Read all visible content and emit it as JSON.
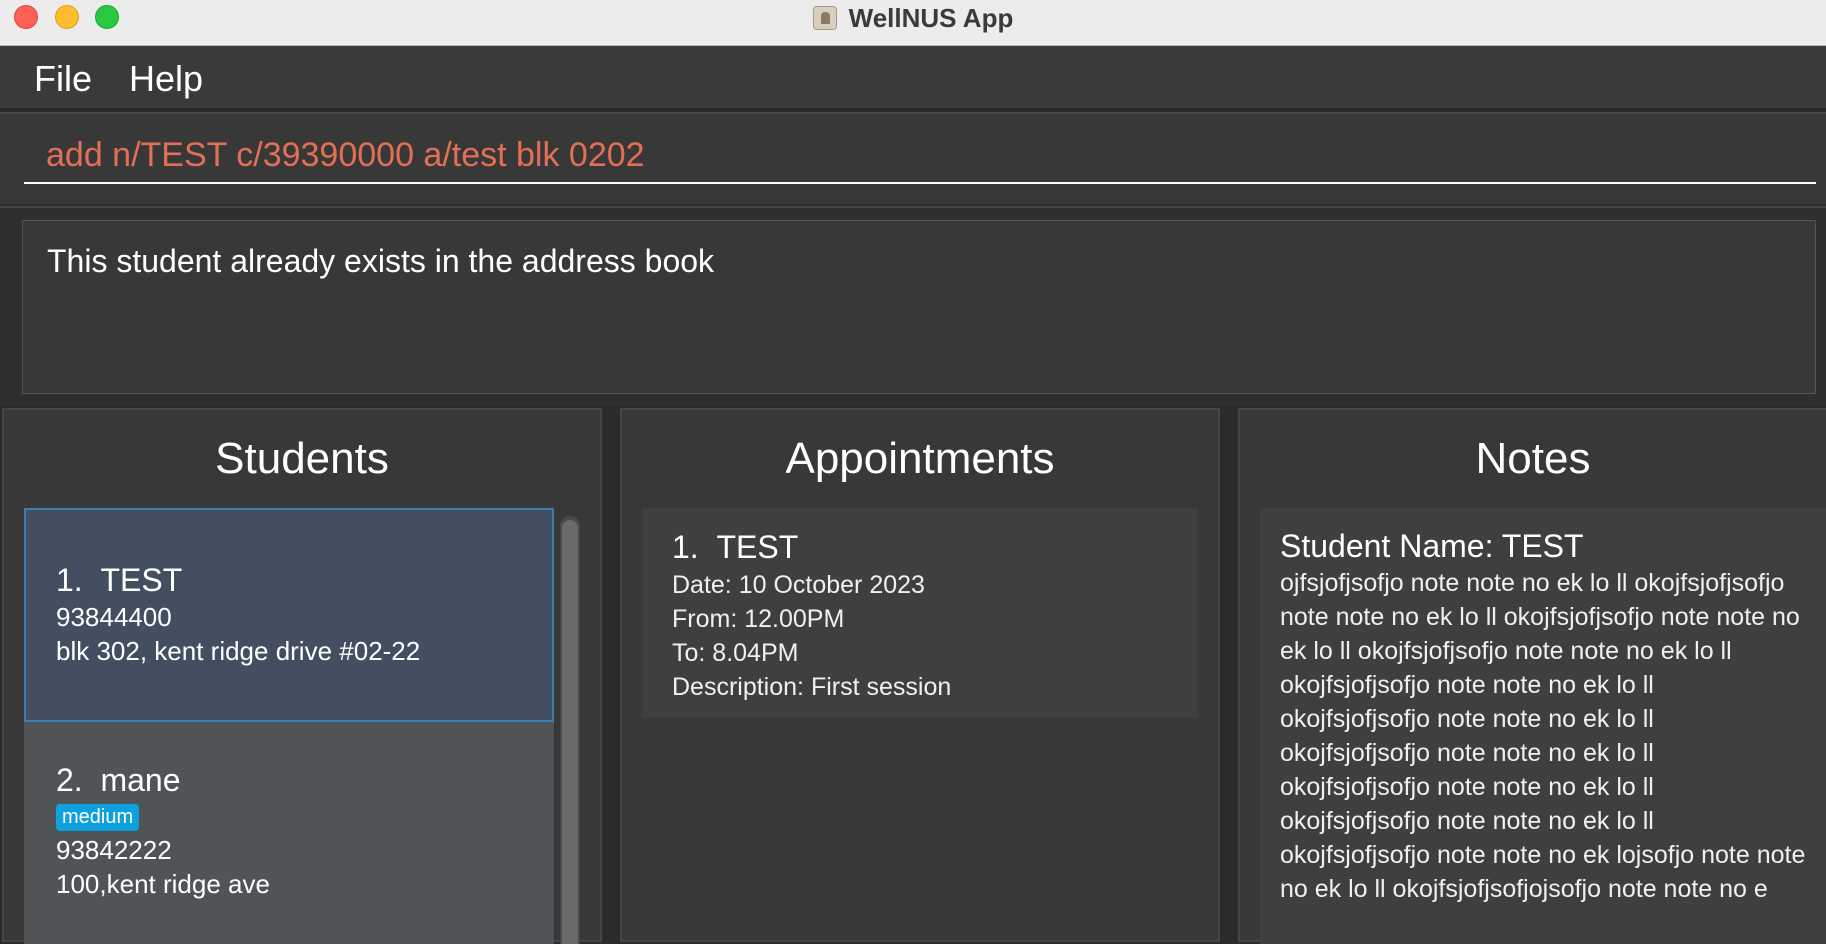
{
  "window": {
    "title": "WellNUS App"
  },
  "menu": {
    "file": "File",
    "help": "Help"
  },
  "command": {
    "value": "add n/TEST c/39390000 a/test blk 0202"
  },
  "result": {
    "message": "This student already exists in the address book"
  },
  "students": {
    "title": "Students",
    "items": [
      {
        "index": "1.",
        "name": "TEST",
        "phone": "93844400",
        "address": "blk 302, kent ridge drive #02-22"
      },
      {
        "index": "2.",
        "name": "mane",
        "tag": "medium",
        "phone": "93842222",
        "address": "100,kent ridge ave"
      }
    ]
  },
  "appointments": {
    "title": "Appointments",
    "items": [
      {
        "index": "1.",
        "name": "TEST",
        "date": "Date: 10 October 2023",
        "from": "From: 12.00PM",
        "to": "To: 8.04PM",
        "description": "Description: First session"
      }
    ]
  },
  "notes": {
    "title": "Notes",
    "student_name": "Student Name: TEST",
    "body": "ojfsjofjsofjo note note no ek lo ll okojfsjofjsofjo note note no ek lo ll okojfsjofjsofjo note note no ek lo ll okojfsjofjsofjo note note no ek lo ll okojfsjofjsofjo note note no ek lo ll okojfsjofjsofjo note note no ek lo ll okojfsjofjsofjo note note no ek lo ll okojfsjofjsofjo note note no ek lo ll okojfsjofjsofjo note note no ek lo ll okojfsjofjsofjo note note no ek lojsofjo note note no ek lo ll okojfsjofjsofjojsofjo note note no e"
  }
}
